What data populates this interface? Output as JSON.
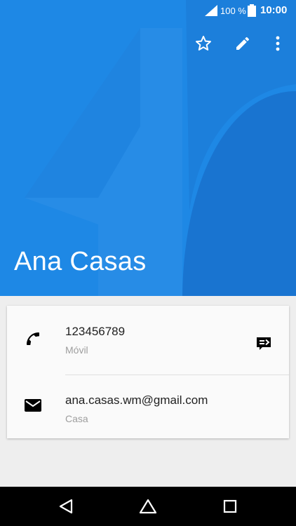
{
  "status_bar": {
    "battery_percent": "100 %",
    "time": "10:00"
  },
  "contact": {
    "name": "Ana Casas",
    "phone": {
      "number": "123456789",
      "type": "Móvil"
    },
    "email": {
      "address": "ana.casas.wm@gmail.com",
      "type": "Casa"
    }
  },
  "colors": {
    "header": "#1e88e5",
    "accent_dark": "#1565c0",
    "card": "#fafafa",
    "background": "#eeeeee"
  },
  "icons": {
    "favorite": "star-outline-icon",
    "edit": "pencil-icon",
    "more": "more-vert-icon",
    "phone": "phone-icon",
    "sms": "message-icon",
    "email": "email-icon",
    "back": "back-triangle-icon",
    "home": "home-icon",
    "recents": "recents-square-icon"
  }
}
